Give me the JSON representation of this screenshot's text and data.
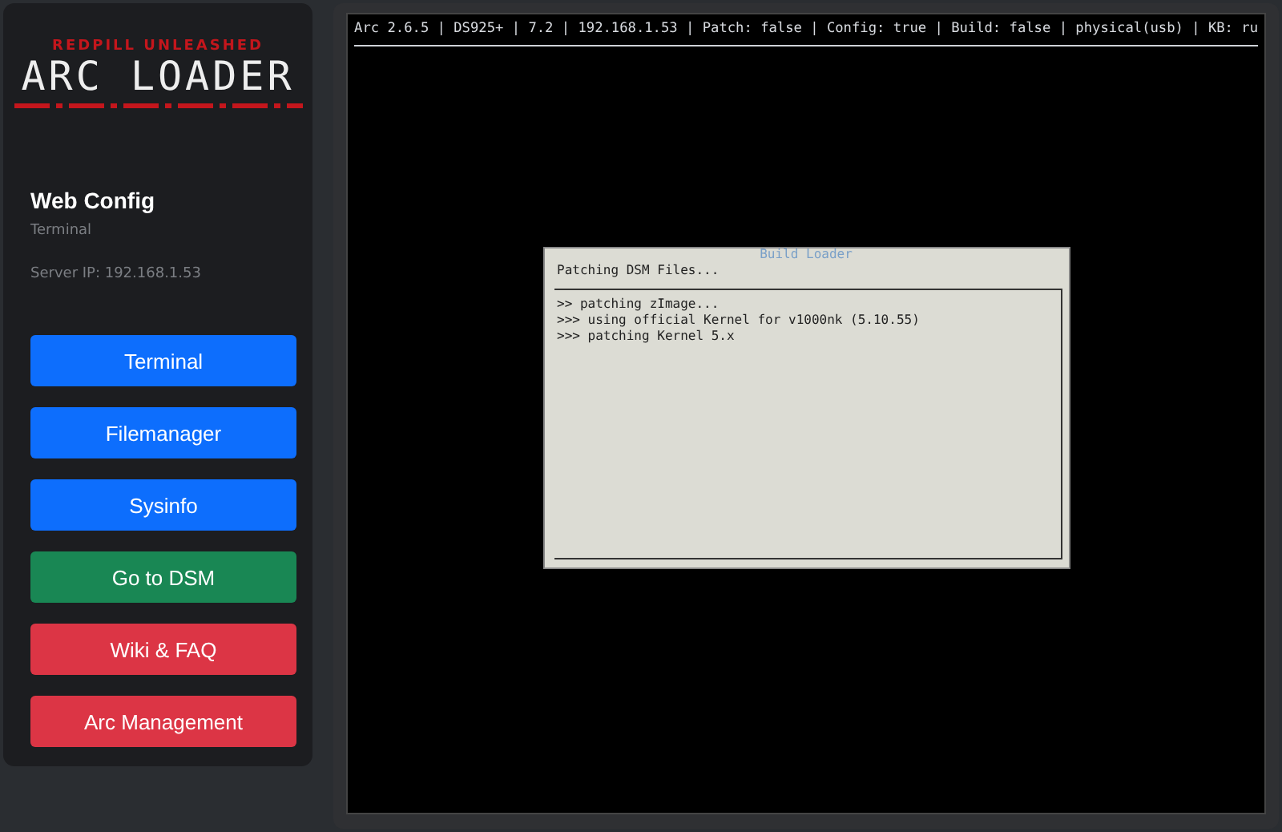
{
  "sidebar": {
    "logo": {
      "tagline": "REDPILL UNLEASHED",
      "title": "ARC LOADER"
    },
    "heading": "Web Config",
    "subtitle": "Terminal",
    "server_ip": "Server IP: 192.168.1.53",
    "buttons": [
      {
        "label": "Terminal",
        "color": "#0d6efd"
      },
      {
        "label": "Filemanager",
        "color": "#0d6efd"
      },
      {
        "label": "Sysinfo",
        "color": "#0d6efd"
      },
      {
        "label": "Go to DSM",
        "color": "#198754"
      },
      {
        "label": "Wiki & FAQ",
        "color": "#dc3545"
      },
      {
        "label": "Arc Management",
        "color": "#dc3545"
      }
    ]
  },
  "terminal": {
    "status_line": "Arc 2.6.5 | DS925+ | 7.2 | 192.168.1.53 | Patch: false | Config: true | Build: false | physical(usb) | KB: ru",
    "dialog": {
      "title": "Build Loader",
      "message": "Patching DSM Files...",
      "log": [
        ">> patching zImage...",
        ">>> using official Kernel for v1000nk (5.10.55)",
        ">>> patching Kernel 5.x"
      ]
    }
  }
}
